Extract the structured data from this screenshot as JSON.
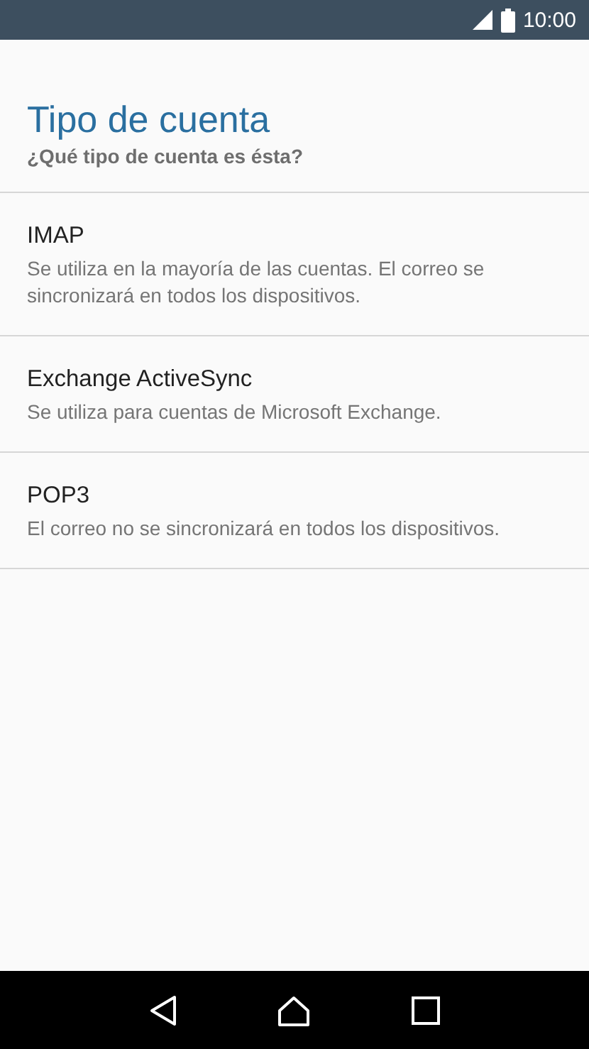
{
  "status_bar": {
    "time": "10:00"
  },
  "header": {
    "title": "Tipo de cuenta",
    "subtitle": "¿Qué tipo de cuenta es ésta?"
  },
  "options": [
    {
      "title": "IMAP",
      "description": "Se utiliza en la mayoría de las cuentas. El correo se sincronizará en todos los dispositivos."
    },
    {
      "title": "Exchange ActiveSync",
      "description": "Se utiliza para cuentas de Microsoft Exchange."
    },
    {
      "title": "POP3",
      "description": "El correo no se sincronizará en todos los dispositivos."
    }
  ]
}
